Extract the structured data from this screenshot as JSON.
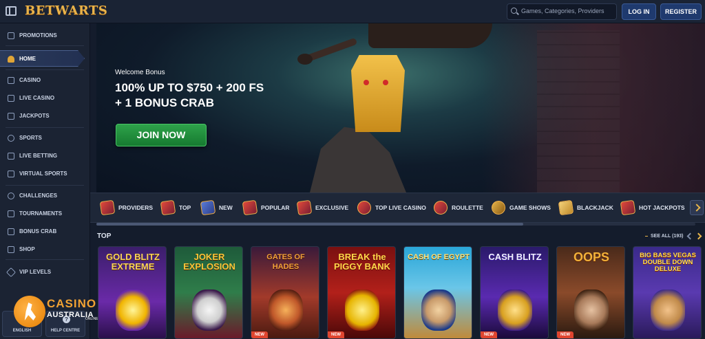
{
  "header": {
    "logo": "BETWARTS",
    "search_placeholder": "Games, Categories, Providers",
    "login": "LOG IN",
    "register": "REGISTER"
  },
  "sidebar": {
    "items": [
      {
        "label": "PROMOTIONS",
        "icon": "gift-icon"
      },
      {
        "label": "HOME",
        "icon": "witch-hat-icon"
      },
      {
        "label": "CASINO",
        "icon": "casino-icon"
      },
      {
        "label": "LIVE CASINO",
        "icon": "live-casino-icon"
      },
      {
        "label": "JACKPOTS",
        "icon": "jackpot-icon"
      },
      {
        "label": "SPORTS",
        "icon": "soccer-ball-icon"
      },
      {
        "label": "LIVE BETTING",
        "icon": "live-betting-icon"
      },
      {
        "label": "VIRTUAL SPORTS",
        "icon": "virtual-sports-icon"
      },
      {
        "label": "CHALLENGES",
        "icon": "medal-icon"
      },
      {
        "label": "TOURNAMENTS",
        "icon": "trophy-icon"
      },
      {
        "label": "BONUS CRAB",
        "icon": "crab-icon"
      },
      {
        "label": "SHOP",
        "icon": "shop-icon"
      },
      {
        "label": "VIP LEVELS",
        "icon": "diamond-icon"
      }
    ],
    "footer": {
      "language": "ENGLISH",
      "help": "HELP CENTRE",
      "help_glyph": "?"
    }
  },
  "watermark": {
    "line1": "CASINO",
    "line2": "AUSTRALIA",
    "line3": "ONLINE"
  },
  "hero": {
    "welcome": "Welcome Bonus",
    "title_line1": "100% UP TO $750 + 200 FS",
    "title_line2": "+ 1 BONUS CRAB",
    "cta": "JOIN NOW"
  },
  "categories": [
    {
      "label": "PROVIDERS",
      "icon": "providers-icon"
    },
    {
      "label": "TOP",
      "icon": "top-icon"
    },
    {
      "label": "NEW",
      "icon": "new-icon"
    },
    {
      "label": "POPULAR",
      "icon": "popular-icon"
    },
    {
      "label": "EXCLUSIVE",
      "icon": "exclusive-icon"
    },
    {
      "label": "TOP LIVE CASINO",
      "icon": "live-casino-chip-icon"
    },
    {
      "label": "ROULETTE",
      "icon": "roulette-icon"
    },
    {
      "label": "GAME SHOWS",
      "icon": "game-shows-icon"
    },
    {
      "label": "BLACKJACK",
      "icon": "blackjack-icon"
    },
    {
      "label": "HOT JACKPOTS",
      "icon": "hot-jackpots-icon"
    }
  ],
  "top_section": {
    "heading": "TOP",
    "see_all": "SEE ALL (193)",
    "games": [
      {
        "title": "GOLD BLITZ EXTREME",
        "badge": ""
      },
      {
        "title": "JOKER EXPLOSION",
        "badge": ""
      },
      {
        "title": "GATES OF HADES",
        "badge": "NEW"
      },
      {
        "title": "BREAK the PIGGY BANK",
        "badge": "NEW"
      },
      {
        "title": "CASH OF EGYPT",
        "badge": ""
      },
      {
        "title": "CASH BLITZ",
        "badge": "NEW"
      },
      {
        "title": "OOPS",
        "badge": "NEW"
      },
      {
        "title": "BIG BASS VEGAS DOUBLE DOWN DELUXE",
        "badge": ""
      }
    ]
  }
}
